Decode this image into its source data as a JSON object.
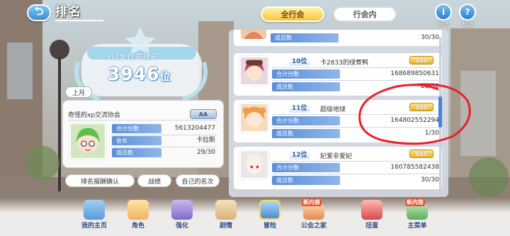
{
  "header": {
    "back_icon": "back-arrow-icon",
    "title": "排名"
  },
  "tabs": [
    {
      "label": "全行会",
      "active": true
    },
    {
      "label": "行会内",
      "active": false
    }
  ],
  "top_icons": [
    {
      "icon": "info-icon",
      "label": "玩法"
    },
    {
      "icon": "help-icon",
      "label": "帮助"
    }
  ],
  "monthly": {
    "title": "9月全行会排名",
    "rank": "3946",
    "rank_suffix": "位",
    "month_tag": "上月"
  },
  "my_guild": {
    "name": "奇怪的xp交流协会",
    "rank_badge": "AA",
    "total_label": "合计分数",
    "total_value": "5613204477",
    "leader_label": "会长",
    "leader_value": "卡拉斯",
    "members_label": "成员数",
    "members_value": "29/30"
  },
  "buttons": {
    "confirm": "排名报酬确认",
    "record": "战绩",
    "own_rank": "自己的名次"
  },
  "list": {
    "partial_top": {
      "members_label": "成员数",
      "members_value": "30/30"
    },
    "entries": [
      {
        "rank": "10位",
        "name": "卡2833的绿煮鸭",
        "badge": "SSS",
        "total_label": "合计分数",
        "total_value": "168689850631",
        "members_label": "成员数",
        "members_value": "28/30"
      },
      {
        "rank": "11位",
        "name": "超级地球",
        "badge": "SSS",
        "total_label": "合计分数",
        "total_value": "164802552294",
        "members_label": "成员数",
        "members_value": "1/30"
      },
      {
        "rank": "12位",
        "name": "妃爱非爱妃",
        "badge": "SSS",
        "total_label": "合计分数",
        "total_value": "160785582438",
        "members_label": "成员数",
        "members_value": "30/30"
      }
    ]
  },
  "nav": [
    {
      "label": "我的主页",
      "icon": "home-icon"
    },
    {
      "label": "角色",
      "icon": "character-icon"
    },
    {
      "label": "强化",
      "icon": "enhance-icon"
    },
    {
      "label": "剧情",
      "icon": "story-icon"
    },
    {
      "label": "冒险",
      "icon": "adventure-icon"
    },
    {
      "label": "公会之家",
      "icon": "guild-house-icon",
      "tag": "新内容"
    },
    {
      "label": "扭蛋",
      "icon": "gacha-icon"
    },
    {
      "label": "主菜单",
      "icon": "main-menu-icon",
      "tag": "新内容"
    }
  ],
  "colors": {
    "accent_blue": "#4c7fd6",
    "gold": "#f3c83a",
    "annotation_red": "#e8202a"
  }
}
